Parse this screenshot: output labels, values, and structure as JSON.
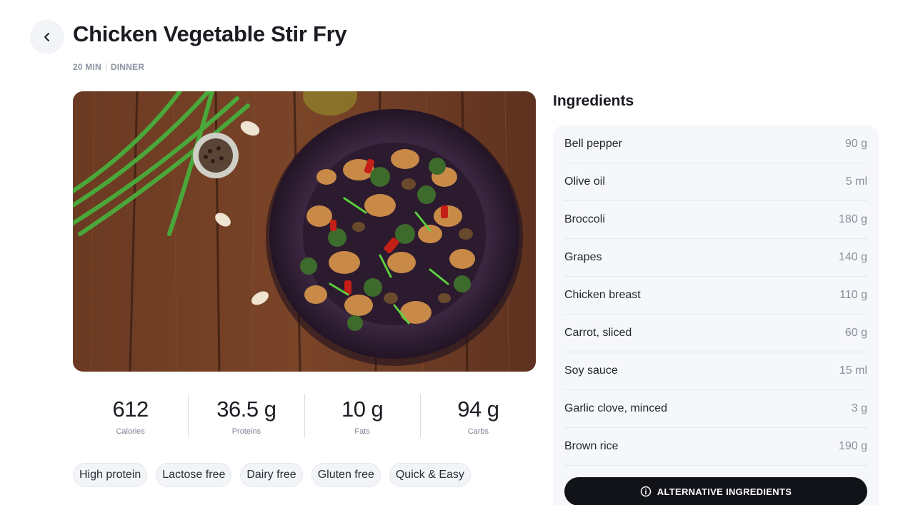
{
  "recipe": {
    "title": "Chicken Vegetable Stir Fry",
    "time": "20 MIN",
    "category": "DINNER"
  },
  "nutrition": [
    {
      "value": "612",
      "label": "Calories"
    },
    {
      "value": "36.5 g",
      "label": "Proteins"
    },
    {
      "value": "10 g",
      "label": "Fats"
    },
    {
      "value": "94 g",
      "label": "Carbs"
    }
  ],
  "tags": [
    "High protein",
    "Lactose free",
    "Dairy free",
    "Gluten free",
    "Quick & Easy"
  ],
  "ingredients": {
    "title": "Ingredients",
    "items": [
      {
        "name": "Bell pepper",
        "qty": "90 g"
      },
      {
        "name": "Olive oil",
        "qty": "5 ml"
      },
      {
        "name": "Broccoli",
        "qty": "180 g"
      },
      {
        "name": "Grapes",
        "qty": "140 g"
      },
      {
        "name": "Chicken breast",
        "qty": "110 g"
      },
      {
        "name": "Carrot, sliced",
        "qty": "60 g"
      },
      {
        "name": "Soy sauce",
        "qty": "15 ml"
      },
      {
        "name": "Garlic clove, minced",
        "qty": "3 g"
      },
      {
        "name": "Brown rice",
        "qty": "190 g"
      }
    ],
    "alt_button_label": "ALTERNATIVE INGREDIENTS"
  },
  "icons": {
    "back": "chevron-left-icon",
    "info": "info-circle-icon"
  },
  "colors": {
    "accent_dark": "#111318",
    "panel_bg": "#f6f7fb",
    "muted_text": "#8d93a1"
  }
}
